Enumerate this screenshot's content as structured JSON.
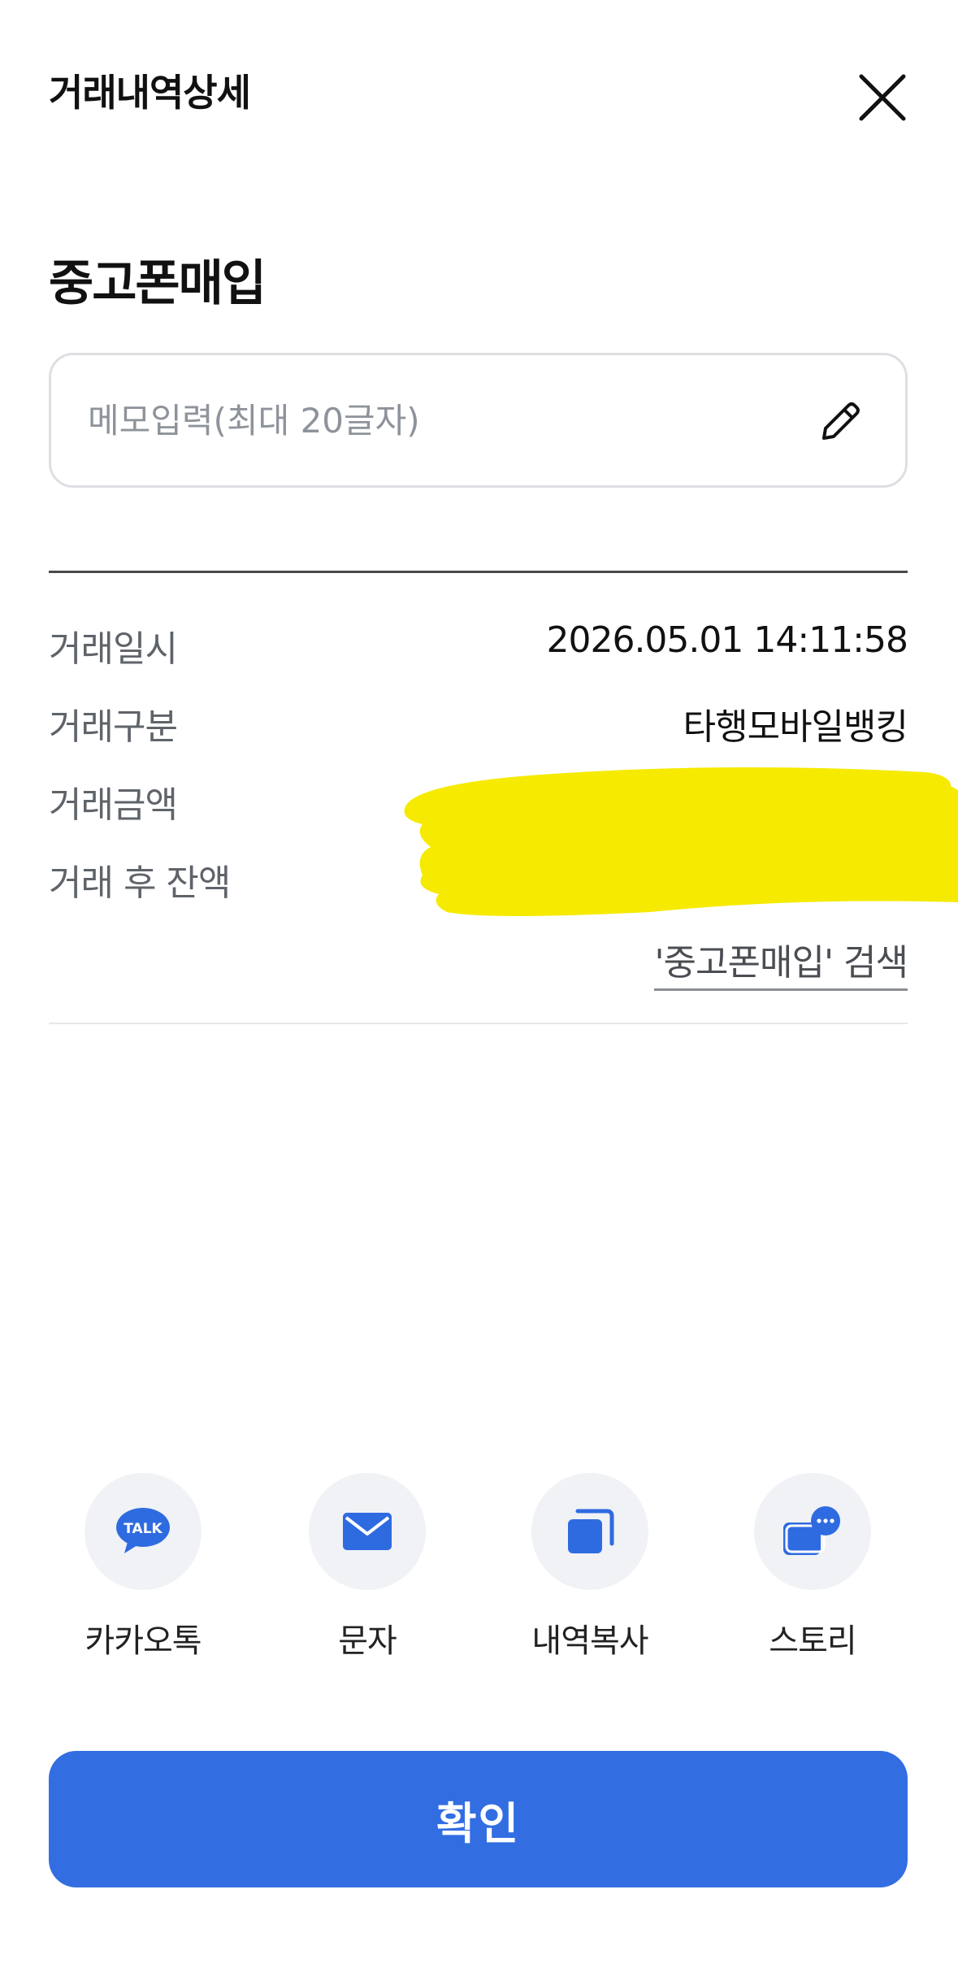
{
  "header": {
    "title": "거래내역상세"
  },
  "transaction": {
    "title": "중고폰매입"
  },
  "memo": {
    "placeholder": "메모입력(최대 20글자)"
  },
  "details": {
    "rows": [
      {
        "label": "거래일시",
        "value": "2026.05.01 14:11:58"
      },
      {
        "label": "거래구분",
        "value": "타행모바일뱅킹"
      },
      {
        "label": "거래금액",
        "value": ""
      },
      {
        "label": "거래 후 잔액",
        "value": ""
      }
    ]
  },
  "search_link": "'중고폰매입' 검색",
  "share": [
    {
      "label": "카카오톡",
      "icon": "kakaotalk-icon",
      "icon_text": "TALK"
    },
    {
      "label": "문자",
      "icon": "message-icon"
    },
    {
      "label": "내역복사",
      "icon": "copy-icon"
    },
    {
      "label": "스토리",
      "icon": "story-icon"
    }
  ],
  "confirm_label": "확인",
  "colors": {
    "accent": "#326ee1",
    "icon_blue": "#2f6be0",
    "redaction": "#f5ea00"
  }
}
